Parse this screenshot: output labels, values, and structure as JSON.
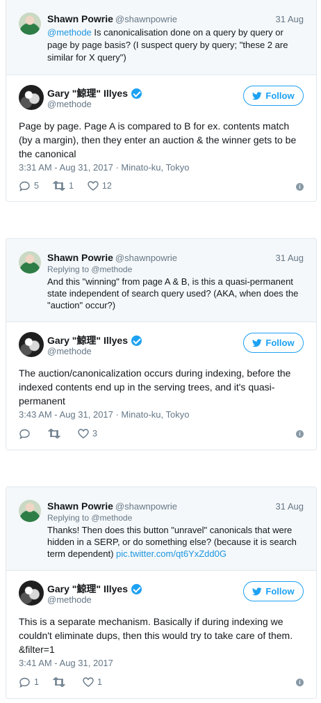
{
  "tweets": [
    {
      "parent": {
        "name": "Shawn Powrie",
        "handle": "@shawnpowrie",
        "date": "31 Aug",
        "replying_label": "",
        "replying_handle": "",
        "mention": "@methode",
        "text": " Is canonicalisation done on a query by query or page by page basis? (I suspect query by query; \"these 2 are similar for X query\")"
      },
      "main": {
        "name": "Gary \"鯨理\" Illyes",
        "handle": "@methode",
        "follow_label": "Follow",
        "text": "Page by page. Page A is compared to B for ex. contents match (by a margin), then they enter an auction & the winner gets to be the canonical",
        "meta": "3:31 AM - Aug 31, 2017 · Minato-ku, Tokyo",
        "replies": "5",
        "retweets": "1",
        "likes": "12"
      }
    },
    {
      "parent": {
        "name": "Shawn Powrie",
        "handle": "@shawnpowrie",
        "date": "31 Aug",
        "replying_label": "Replying to ",
        "replying_handle": "@methode",
        "text": "And this \"winning\" from page A & B, is this a quasi-permanent state independent of search query used? (AKA, when does the \"auction\" occur?)"
      },
      "main": {
        "name": "Gary \"鯨理\" Illyes",
        "handle": "@methode",
        "follow_label": "Follow",
        "text": "The auction/canonicalization occurs during indexing, before the indexed contents end up in the serving trees, and it's quasi-permanent",
        "meta": "3:43 AM - Aug 31, 2017 · Minato-ku, Tokyo",
        "replies": "",
        "retweets": "",
        "likes": "3"
      }
    },
    {
      "parent": {
        "name": "Shawn Powrie",
        "handle": "@shawnpowrie",
        "date": "31 Aug",
        "replying_label": "Replying to ",
        "replying_handle": "@methode",
        "text": "Thanks! Then does this button \"unravel\" canonicals that were hidden in a SERP, or do something else? (because it is search term dependent) ",
        "link": "pic.twitter.com/qt6YxZdd0G"
      },
      "main": {
        "name": "Gary \"鯨理\" Illyes",
        "handle": "@methode",
        "follow_label": "Follow",
        "text": "This is a separate mechanism. Basically if during indexing we couldn't eliminate dups, then this would try to take care of them. &filter=1",
        "meta": "3:41 AM - Aug 31, 2017",
        "replies": "1",
        "retweets": "",
        "likes": "1"
      }
    }
  ],
  "icons": {
    "reply": "reply-icon",
    "retweet": "retweet-icon",
    "like": "heart-icon",
    "info": "info-icon",
    "follow": "twitter-bird-icon",
    "verified": "verified-badge-icon"
  },
  "colors": {
    "accent": "#1da1f2",
    "link": "#1b95e0",
    "muted": "#657786",
    "parent_bg": "#f5f8fa",
    "border": "#e1e8ed"
  }
}
